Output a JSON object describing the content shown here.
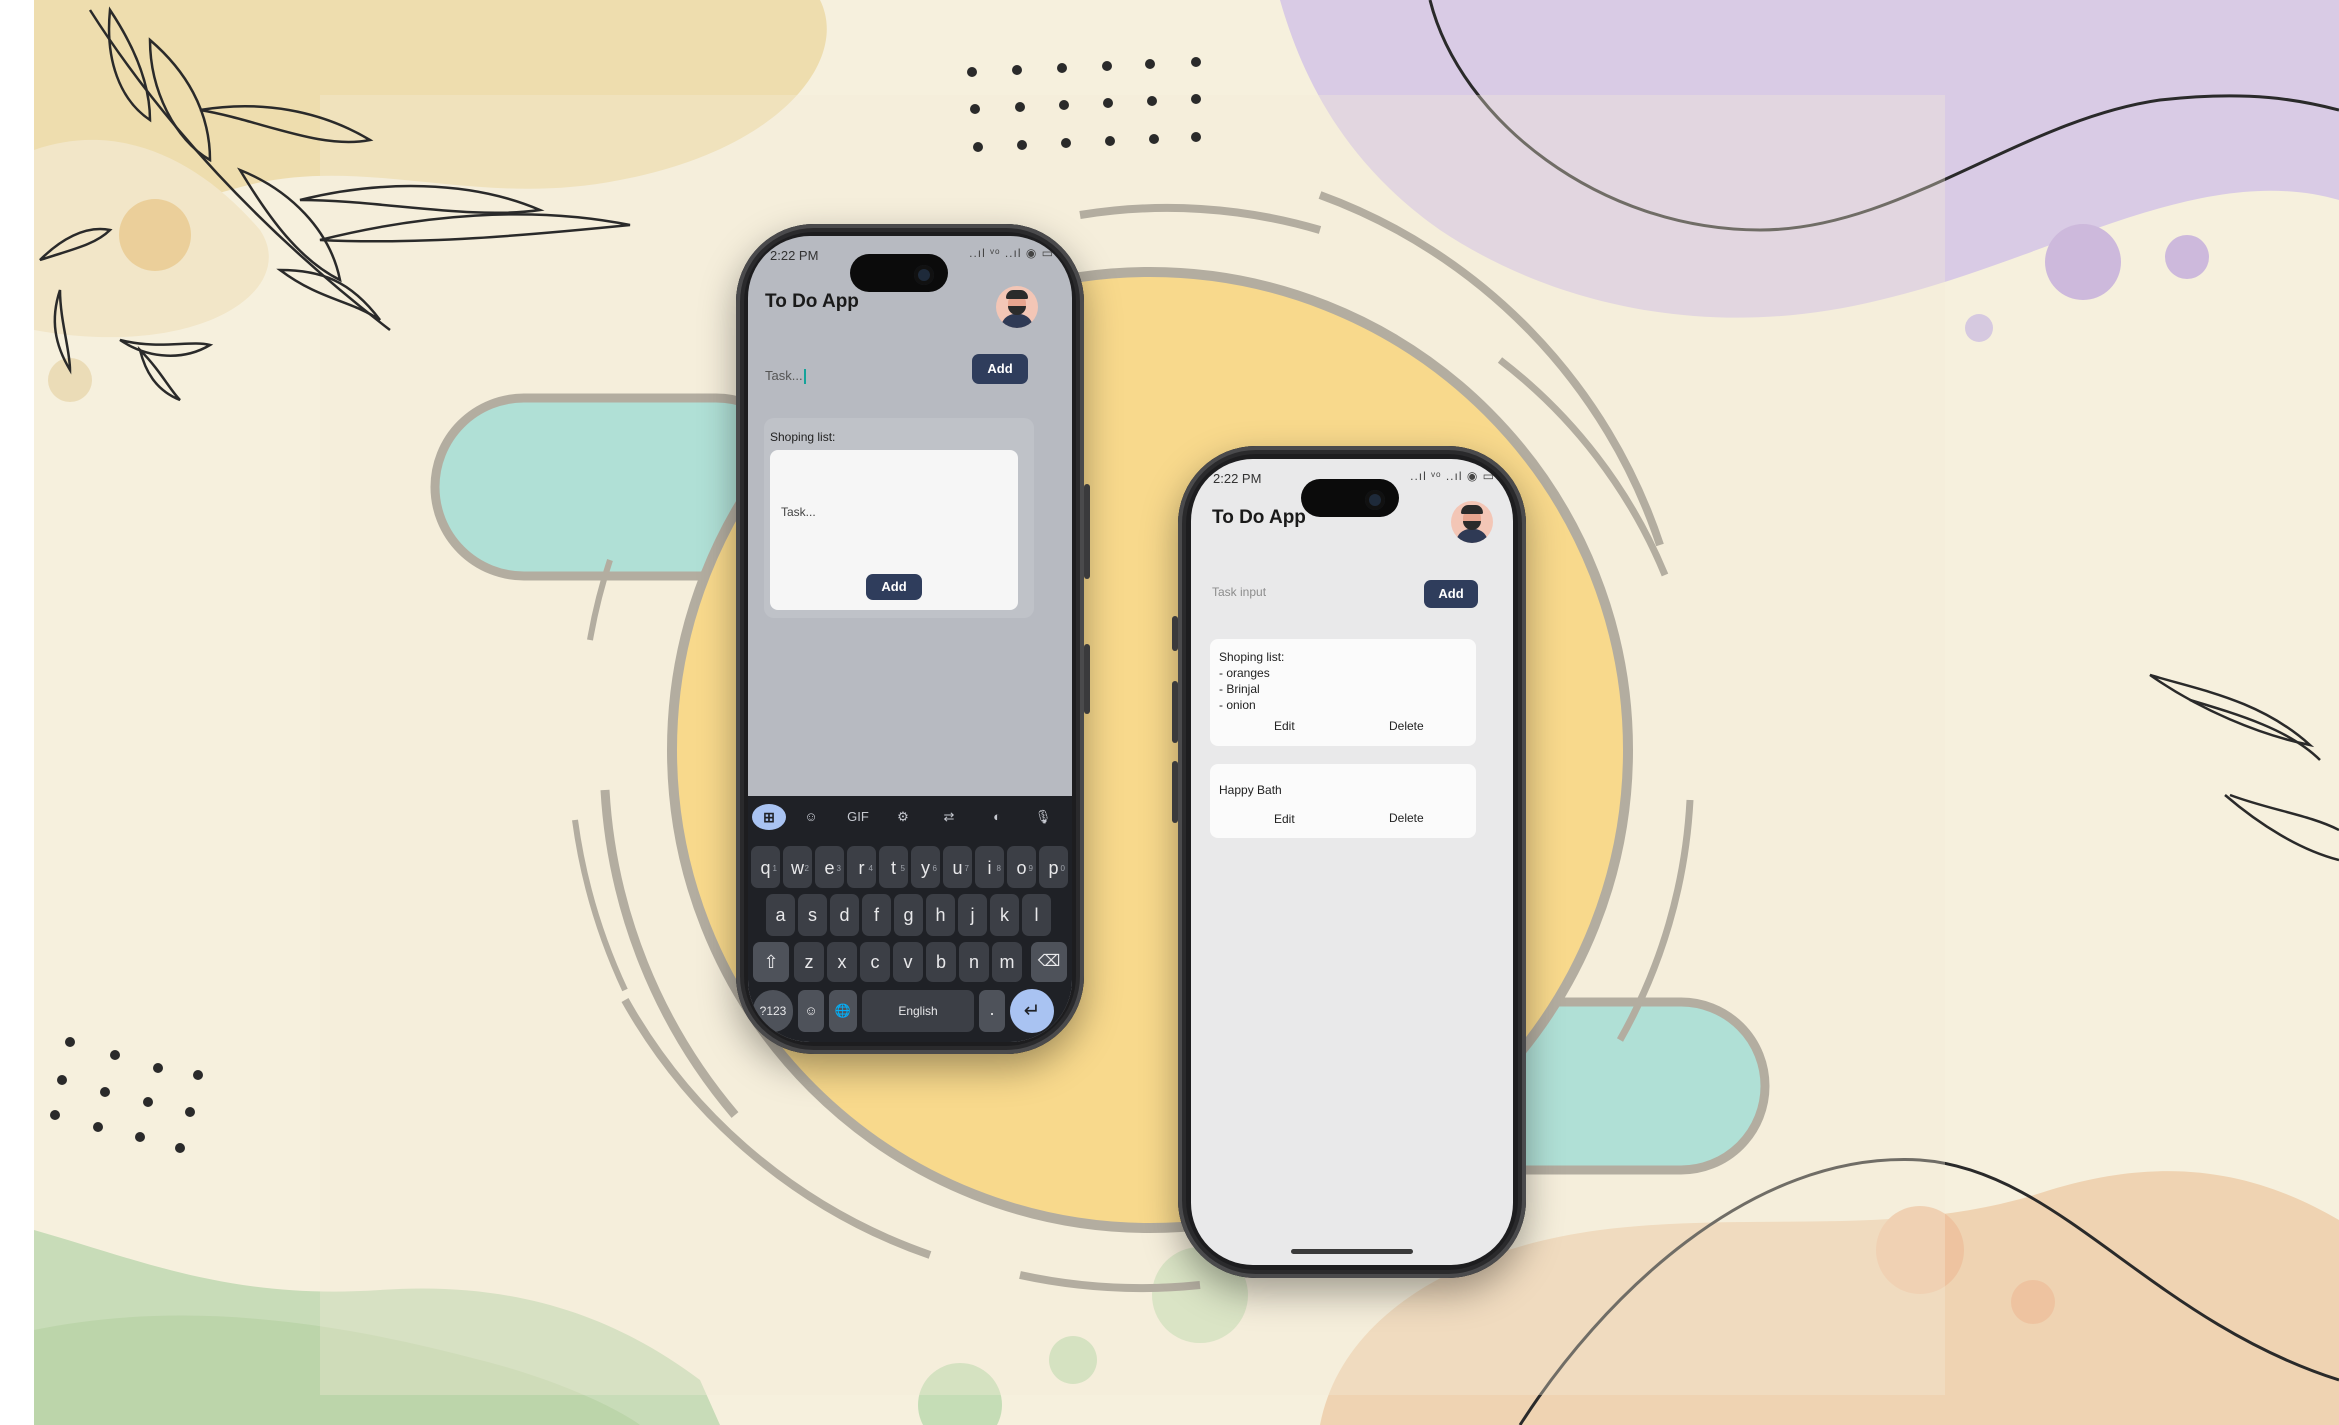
{
  "colors": {
    "background": "#f6f0dd",
    "sun": "#f8d98c",
    "accent_teal": "#b0e0d6",
    "accent_purple": "#d9cbe5",
    "button": "#2f3d5c",
    "keyboard": "#1f2126",
    "enter_key": "#a9c3f2"
  },
  "phone_left": {
    "status": {
      "time": "2:22 PM",
      "right": "..ıl ᵛᵒ ..ıl ◉ ▭"
    },
    "app_title": "To Do App",
    "avatar_icon": "avatar-person-icon",
    "task_input": {
      "value": "Task..."
    },
    "add_label": "Add",
    "card": {
      "label": "Shoping list:",
      "input_placeholder": "Task...",
      "add_label": "Add"
    },
    "keyboard": {
      "toolbar": [
        {
          "name": "apps-icon",
          "label": "⊞"
        },
        {
          "name": "sticker-icon",
          "label": "☺"
        },
        {
          "name": "gif-button",
          "label": "GIF"
        },
        {
          "name": "settings-icon",
          "label": "⚙"
        },
        {
          "name": "translate-icon",
          "label": "⇄"
        },
        {
          "name": "palette-icon",
          "label": "◐"
        },
        {
          "name": "microphone-icon",
          "label": "🎙"
        }
      ],
      "row1": [
        {
          "k": "q",
          "h": "1"
        },
        {
          "k": "w",
          "h": "2"
        },
        {
          "k": "e",
          "h": "3"
        },
        {
          "k": "r",
          "h": "4"
        },
        {
          "k": "t",
          "h": "5"
        },
        {
          "k": "y",
          "h": "6"
        },
        {
          "k": "u",
          "h": "7"
        },
        {
          "k": "i",
          "h": "8"
        },
        {
          "k": "o",
          "h": "9"
        },
        {
          "k": "p",
          "h": "0"
        }
      ],
      "row2": [
        "a",
        "s",
        "d",
        "f",
        "g",
        "h",
        "j",
        "k",
        "l"
      ],
      "row3": [
        "z",
        "x",
        "c",
        "v",
        "b",
        "n",
        "m"
      ],
      "shift": "⇧",
      "backspace": "⌫",
      "symbols": "?123",
      "emoji": "☺",
      "globe": "🌐",
      "space": "English",
      "period": ".",
      "enter": "↵"
    }
  },
  "phone_right": {
    "status": {
      "time": "2:22 PM",
      "right": "..ıl ᵛᵒ ..ıl ◉ ▭"
    },
    "app_title": "To Do App",
    "avatar_icon": "avatar-person-icon",
    "task_input_placeholder": "Task input",
    "add_label": "Add",
    "notes": [
      {
        "lines": [
          "Shoping list:",
          "- oranges",
          "- Brinjal",
          "- onion"
        ],
        "edit_label": "Edit",
        "delete_label": "Delete"
      },
      {
        "lines": [
          "Happy Bath"
        ],
        "edit_label": "Edit",
        "delete_label": "Delete"
      }
    ]
  }
}
